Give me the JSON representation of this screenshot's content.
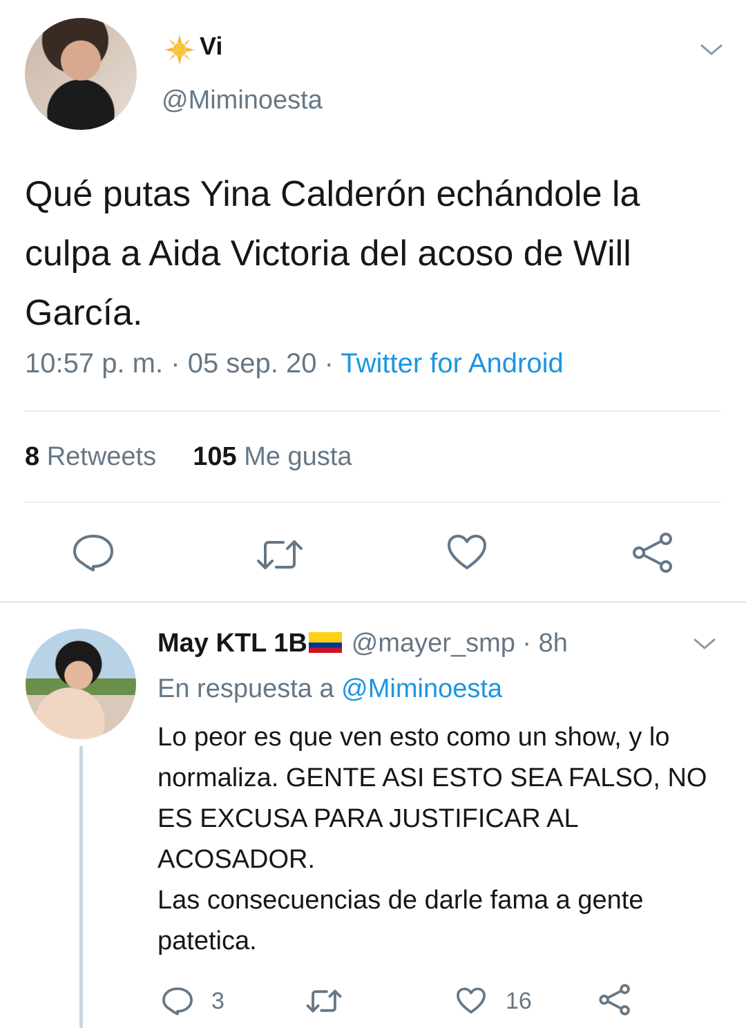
{
  "main_tweet": {
    "display_name": "Vi",
    "name_emoji_icon": "sun-icon",
    "handle": "@Miminoesta",
    "text": "Qué putas Yina Calderón echándole la culpa a Aida Victoria del acoso de Will García.",
    "time": "10:57 p. m.",
    "date": "05 sep. 20",
    "source": "Twitter for Android",
    "retweets_count": "8",
    "retweets_label": "Retweets",
    "likes_count": "105",
    "likes_label": "Me gusta",
    "actions": [
      "reply-icon",
      "retweet-icon",
      "like-icon",
      "share-icon"
    ]
  },
  "reply": {
    "display_name": "May KTL 1B",
    "flag_icon": "colombia-flag-icon",
    "handle": "@mayer_smp",
    "age": "8h",
    "reply_to_prefix": "En respuesta a",
    "reply_to_handle": "@Miminoesta",
    "text": "Lo peor es que ven esto como un show, y lo normaliza. GENTE ASI ESTO SEA FALSO, NO ES EXCUSA PARA JUSTIFICAR AL ACOSADOR.\nLas consecuencias de darle fama a gente patetica.",
    "reply_count": "3",
    "like_count": "16"
  },
  "colors": {
    "text_primary": "#14171a",
    "text_secondary": "#657786",
    "link": "#1b95e0",
    "divider": "#e6ecf0"
  }
}
